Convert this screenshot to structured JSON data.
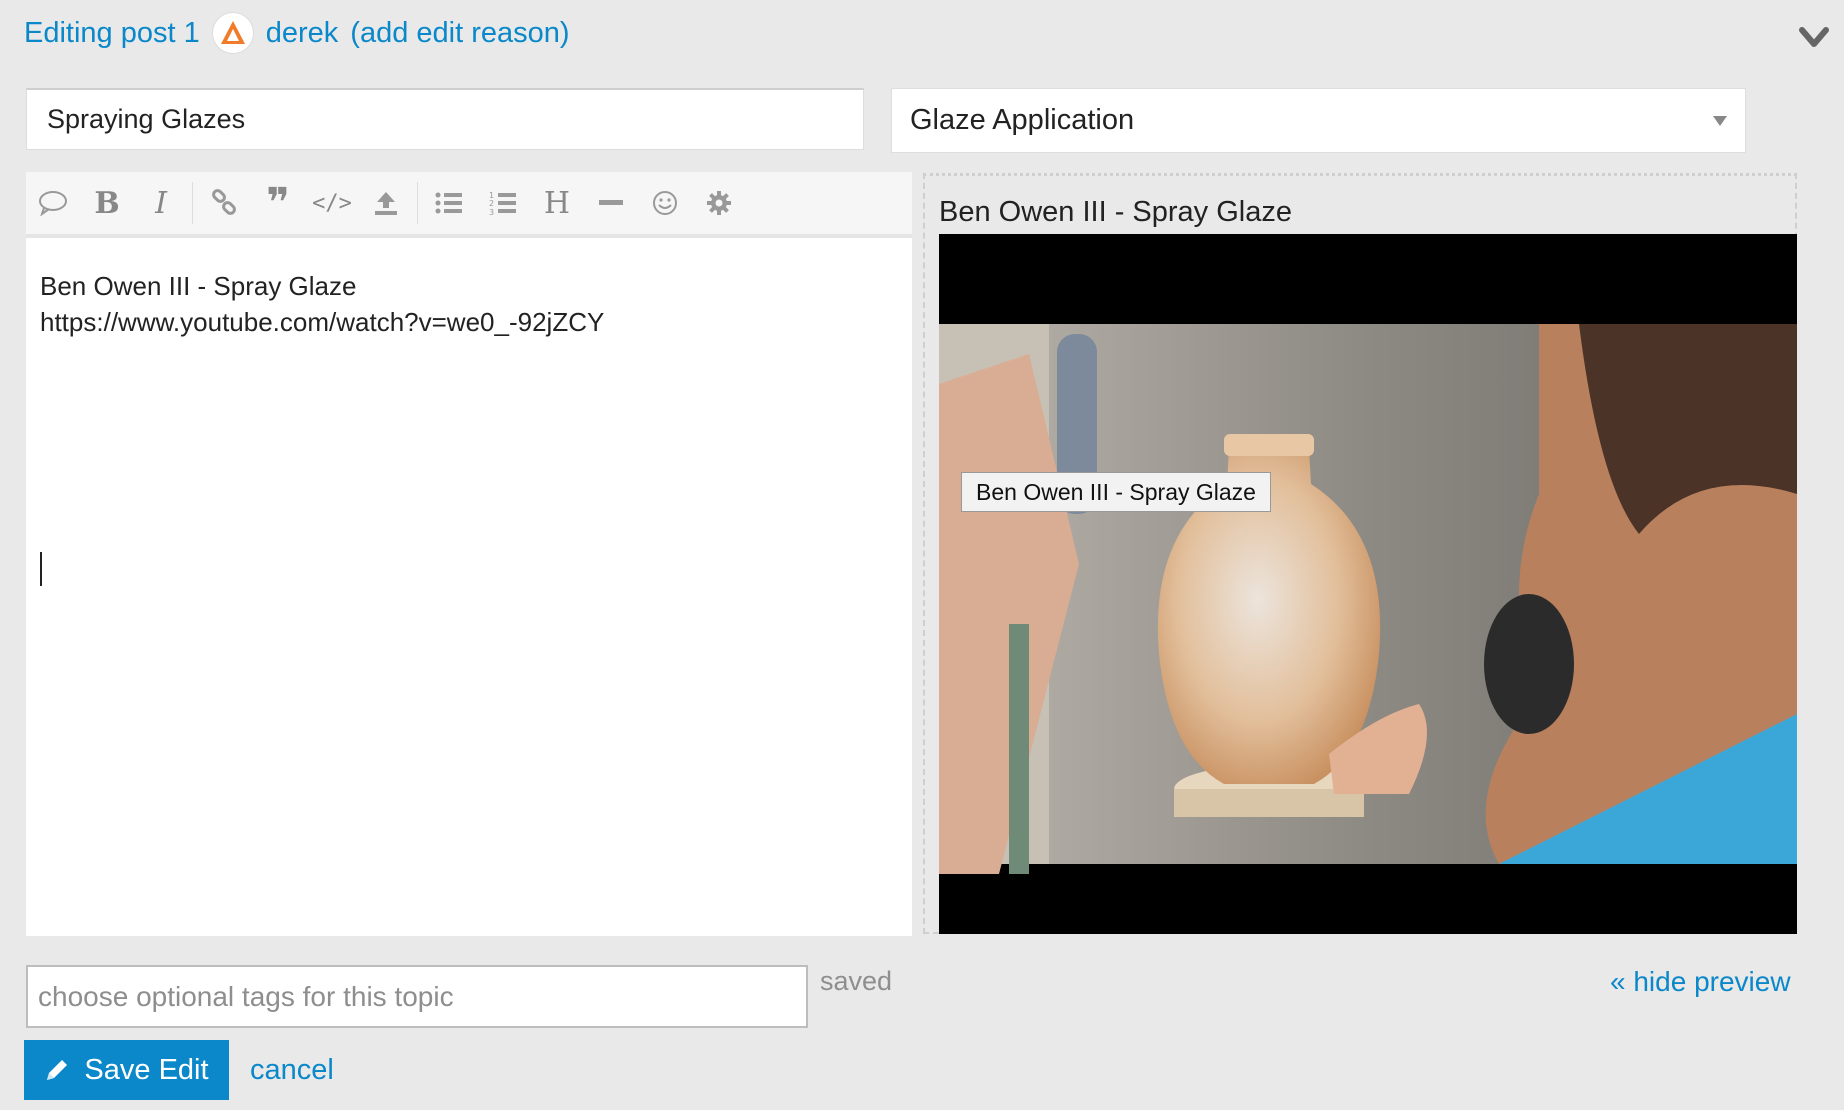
{
  "header": {
    "editing_label": "Editing post 1",
    "author": "derek",
    "edit_reason_link": "(add edit reason)"
  },
  "title_input": {
    "value": "Spraying Glazes"
  },
  "category": {
    "selected": "Glaze Application"
  },
  "toolbar": {
    "buttons": [
      "quote",
      "bold",
      "italic",
      "link",
      "blockquote",
      "code",
      "upload",
      "bulleted-list",
      "numbered-list",
      "heading",
      "horizontal-rule",
      "emoji",
      "options"
    ]
  },
  "editor": {
    "line1": "Ben Owen III - Spray Glaze",
    "line2": "https://www.youtube.com/watch?v=we0_-92jZCY"
  },
  "preview": {
    "title": "Ben Owen III - Spray Glaze",
    "video_tooltip": "Ben Owen III - Spray Glaze"
  },
  "tags": {
    "placeholder": "choose optional tags for this topic"
  },
  "status": {
    "saved": "saved"
  },
  "links": {
    "hide_preview": "« hide preview",
    "cancel": "cancel"
  },
  "buttons": {
    "save_edit": "Save Edit"
  },
  "colors": {
    "accent": "#0a88c9",
    "background": "#e9e9e9"
  }
}
